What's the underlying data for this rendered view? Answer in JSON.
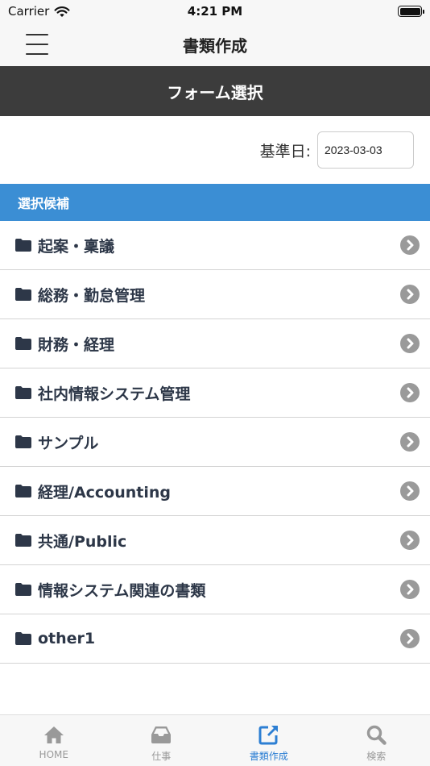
{
  "status_bar": {
    "carrier": "Carrier",
    "time": "4:21 PM"
  },
  "nav": {
    "title": "書類作成",
    "menu_icon": "hamburger-icon"
  },
  "section_header": "フォーム選択",
  "date_filter": {
    "label": "基準日:",
    "value": "2023-03-03"
  },
  "list_header": "選択候補",
  "items": [
    {
      "label": "起案・稟議"
    },
    {
      "label": "総務・勤怠管理"
    },
    {
      "label": "財務・経理"
    },
    {
      "label": "社内情報システム管理"
    },
    {
      "label": "サンプル"
    },
    {
      "label": "経理/Accounting"
    },
    {
      "label": "共通/Public"
    },
    {
      "label": "情報システム関連の書類"
    },
    {
      "label": "other1"
    }
  ],
  "tabs": [
    {
      "label": "HOME",
      "icon": "home-icon",
      "active": false
    },
    {
      "label": "仕事",
      "icon": "inbox-icon",
      "active": false
    },
    {
      "label": "書類作成",
      "icon": "edit-external-icon",
      "active": true
    },
    {
      "label": "検索",
      "icon": "search-icon",
      "active": false
    }
  ],
  "colors": {
    "accent": "#2d7fd3",
    "list_header": "#3b8ed4",
    "section_header": "#3c3c3c"
  }
}
